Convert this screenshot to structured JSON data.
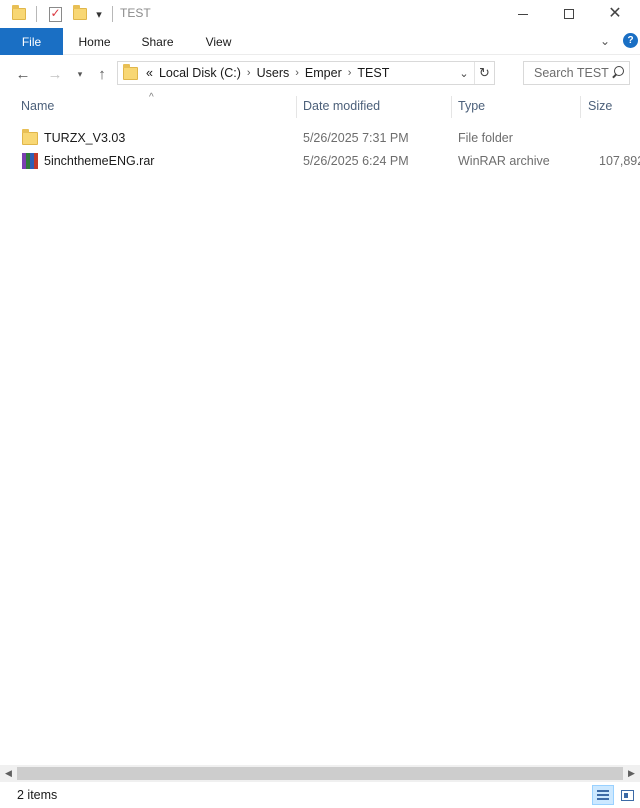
{
  "window": {
    "title": "TEST",
    "quick_access_dropdown": "▾",
    "controls": {
      "minimize": "—",
      "maximize": "☐",
      "close": "✕"
    }
  },
  "ribbon": {
    "tabs": [
      "File",
      "Home",
      "Share",
      "View"
    ],
    "expand_chevron": "⌄",
    "help": "?"
  },
  "nav": {
    "back": "←",
    "forward": "→",
    "up": "↑",
    "overflow": "«",
    "breadcrumbs": [
      "Local Disk (C:)",
      "Users",
      "Emper",
      "TEST"
    ],
    "separator": "›",
    "dropdown": "⌄",
    "refresh": "↻",
    "search_placeholder": "Search TEST"
  },
  "columns": {
    "sort_indicator": "^",
    "name": "Name",
    "date": "Date modified",
    "type": "Type",
    "size": "Size"
  },
  "files": [
    {
      "icon": "folder-icon",
      "name": "TURZX_V3.03",
      "date": "5/26/2025 7:31 PM",
      "type": "File folder",
      "size": ""
    },
    {
      "icon": "winrar-icon",
      "name": "5inchthemeENG.rar",
      "date": "5/26/2025 6:24 PM",
      "type": "WinRAR archive",
      "size": "107,892"
    }
  ],
  "scrollbar": {
    "left_arrow": "◀",
    "right_arrow": "▶"
  },
  "status": {
    "item_count": "2 items"
  },
  "colors": {
    "file_tab": "#1a6fc4",
    "header_text": "#4c607a",
    "folder": "#f8d774",
    "active_view": "#cce8ff"
  }
}
